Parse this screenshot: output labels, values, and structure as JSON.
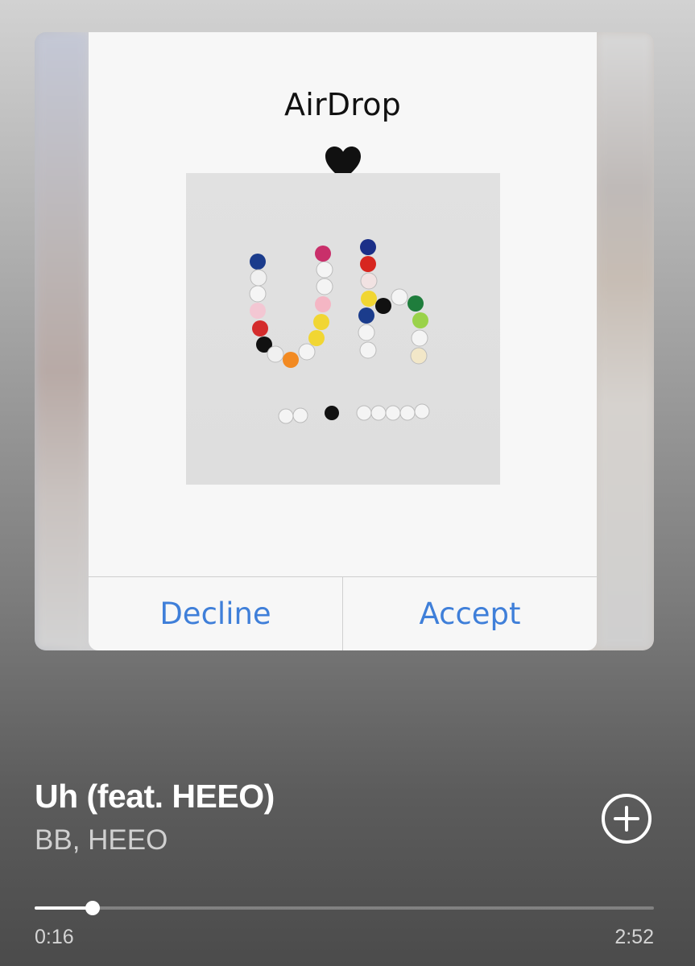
{
  "airdrop": {
    "title": "AirDrop",
    "sender_icon": "black-heart-icon",
    "decline_label": "Decline",
    "accept_label": "Accept",
    "button_color": "#3f7fd9"
  },
  "cover_art": {
    "icon": "album-cover-image",
    "big_text": "Uh",
    "caption": [
      "BB",
      "x",
      "HEEO"
    ]
  },
  "track": {
    "title": "Uh (feat. HEEO)",
    "artist": "BB, HEEO",
    "add_icon": "plus-circle-icon"
  },
  "playback": {
    "elapsed": "0:16",
    "total": "2:52",
    "progress_fraction": 0.093
  }
}
